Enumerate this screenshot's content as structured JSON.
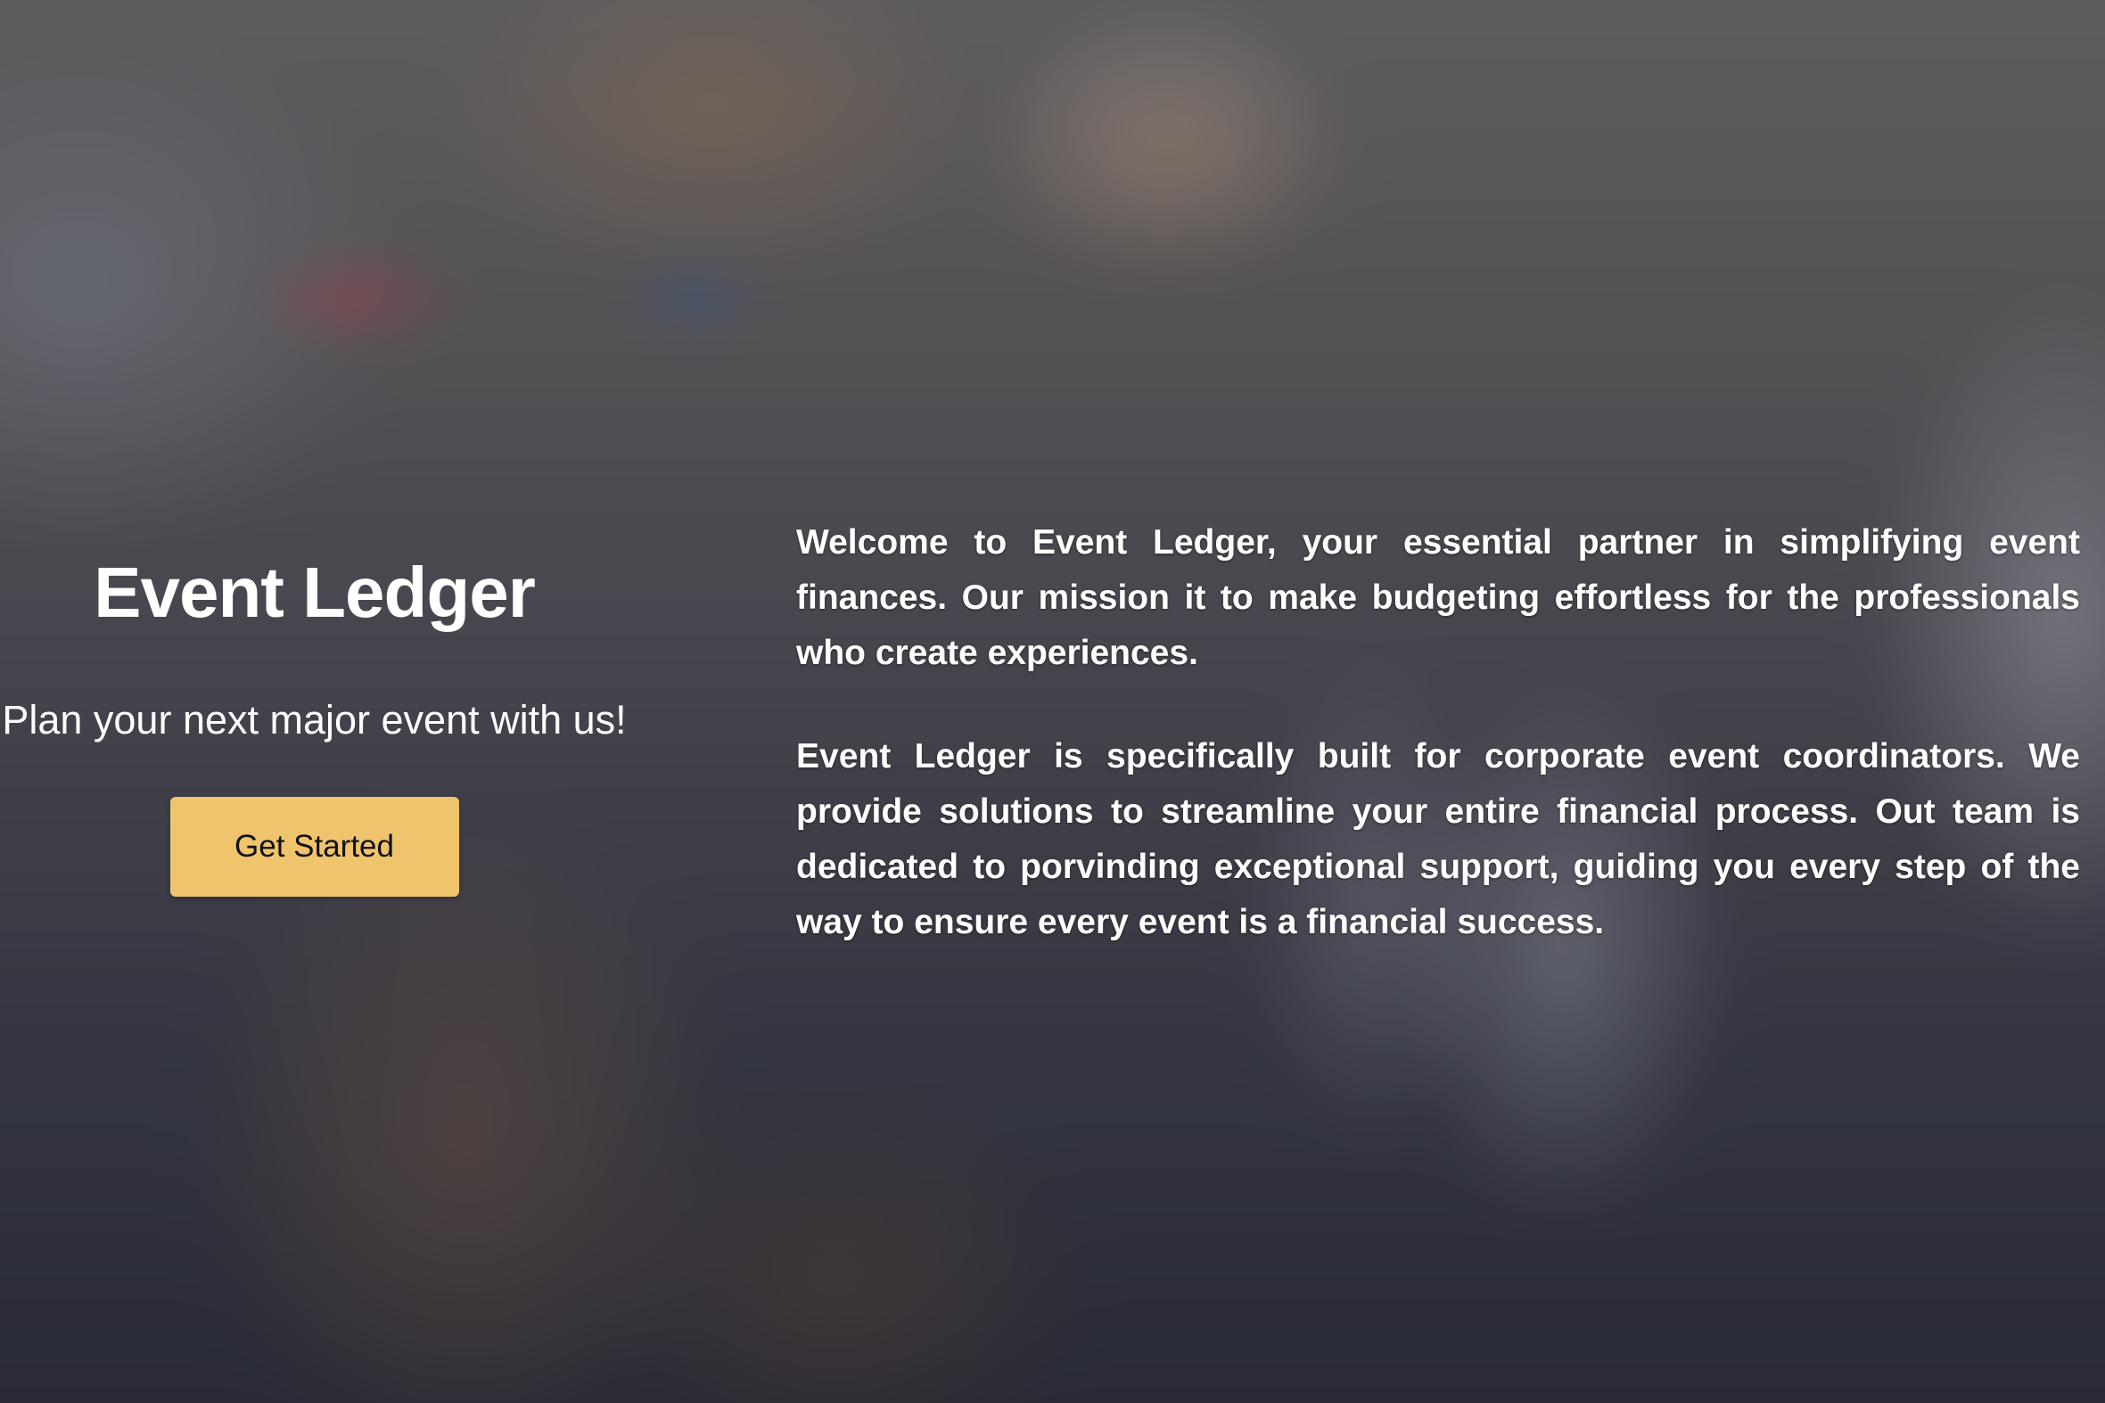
{
  "hero": {
    "title": "Event Ledger",
    "tagline": "Plan your next major event with us!",
    "cta_label": "Get Started",
    "cta_color": "#efc46d"
  },
  "about": {
    "paragraphs": [
      "Welcome to Event Ledger, your essential partner in simplifying event finances. Our mission it to make budgeting effortless for the professionals who create experiences.",
      "Event Ledger is specifically built for corporate event coordinators. We provide solutions to streamline your entire financial process. Out team is dedicated to porvinding exceptional support, guiding you every step of the way to ensure every event is a financial success."
    ]
  }
}
